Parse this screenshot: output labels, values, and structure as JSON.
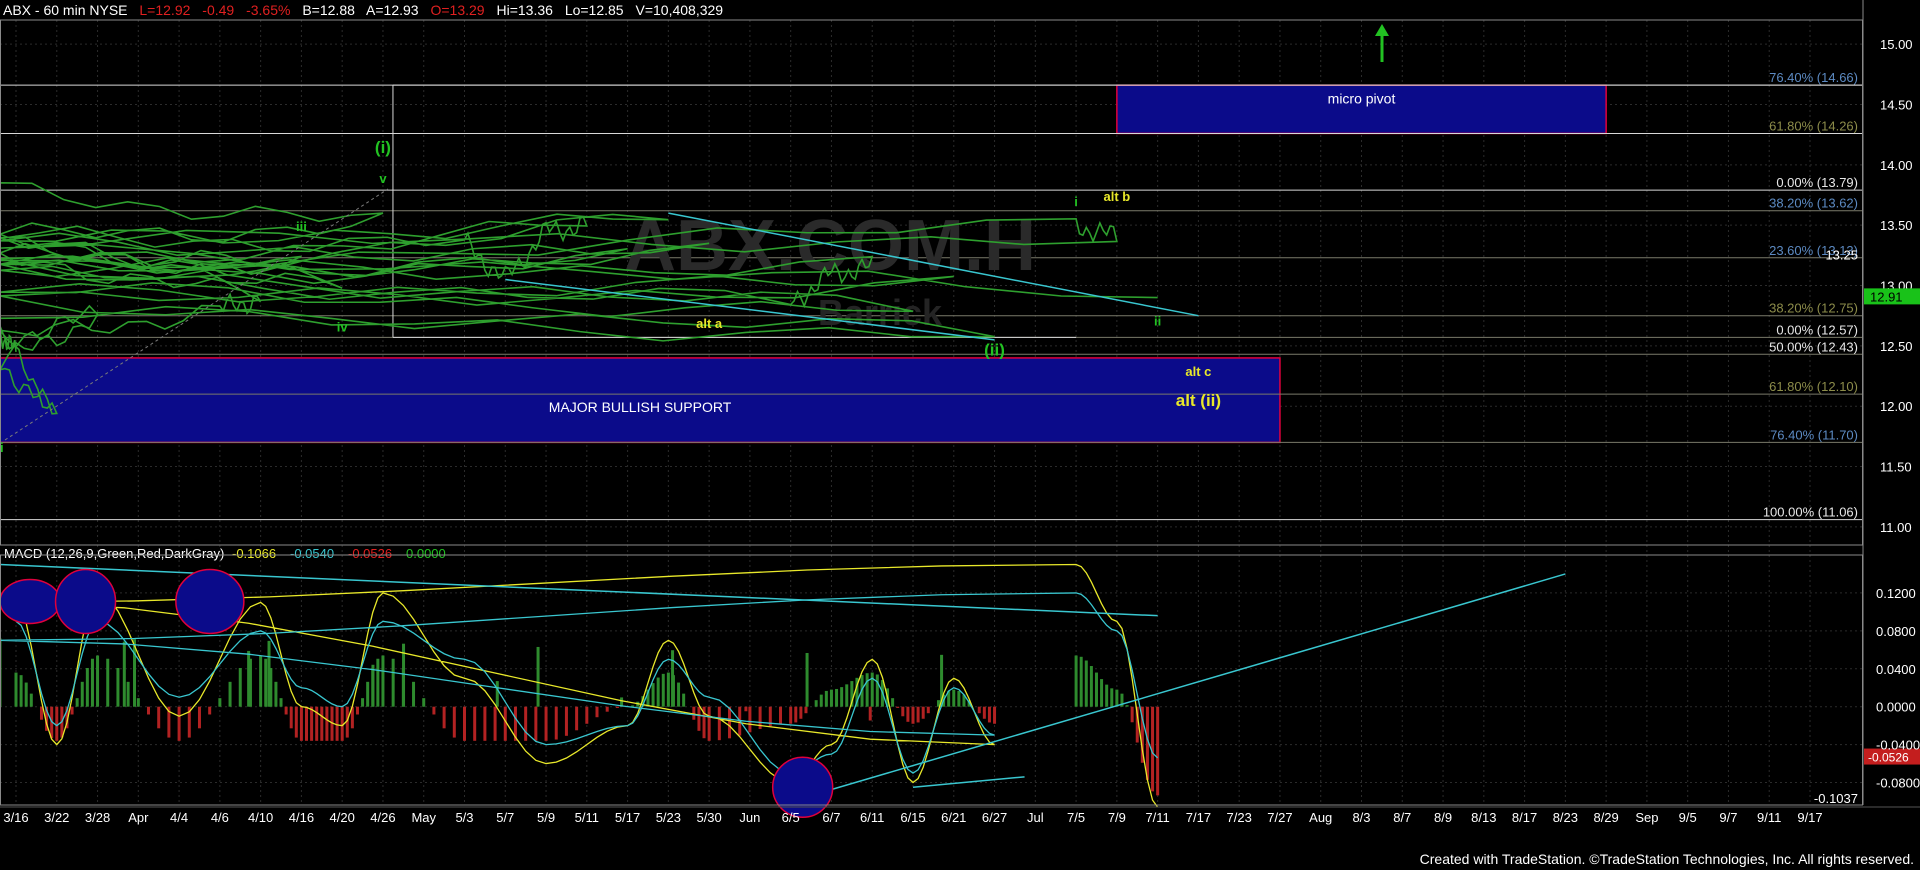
{
  "header": {
    "symbol": "ABX - 60 min NYSE",
    "last": "L=12.92",
    "change": "-0.49",
    "change_pct": "-3.65%",
    "bid": "B=12.88",
    "ask": "A=12.93",
    "open": "O=13.29",
    "high": "Hi=13.36",
    "low": "Lo=12.85",
    "volume": "V=10,408,329"
  },
  "watermark": "ABX.COM.H",
  "watermark_sub": "Barrick",
  "footer": "Created with TradeStation. ©TradeStation Technologies, Inc. All rights reserved.",
  "colors": {
    "background": "#000000",
    "price": "#2e9f2e",
    "fib_label": "#5c8ac2",
    "support_box": "#0b0b8a",
    "box_border": "#e0003c",
    "wave_green": "#22c222",
    "wave_yellow": "#e8e82a",
    "trendline": "#39c6cf",
    "macd_pos": "#2e8b2e",
    "macd_neg": "#b22222",
    "last_price_bg": "#19c219"
  },
  "chart_data": [
    {
      "type": "line",
      "title": "ABX - 60 min NYSE",
      "ylim": [
        10.85,
        15.2
      ],
      "y_ticks": [
        "15.00",
        "14.50",
        "14.00",
        "13.50",
        "13.00",
        "12.50",
        "12.00",
        "11.50",
        "11.00"
      ],
      "x_tick_labels": [
        "3/16",
        "3/22",
        "3/28",
        "Apr",
        "4/4",
        "4/6",
        "4/10",
        "4/16",
        "4/20",
        "4/26",
        "May",
        "5/3",
        "5/7",
        "5/9",
        "5/11",
        "5/17",
        "5/23",
        "5/30",
        "Jun",
        "6/5",
        "6/7",
        "6/11",
        "6/15",
        "6/21",
        "6/27",
        "Jul",
        "7/5",
        "7/9",
        "7/11",
        "7/17",
        "7/23",
        "7/27",
        "Aug",
        "8/3",
        "8/7",
        "8/9",
        "8/13",
        "8/17",
        "8/23",
        "8/29",
        "Sep",
        "9/5",
        "9/7",
        "9/11",
        "9/17"
      ],
      "series": [
        {
          "x": [
            "3/16",
            "3/20",
            "3/22",
            "3/26",
            "3/28",
            "4/2",
            "4/6",
            "4/10",
            "4/12",
            "4/16",
            "4/18",
            "4/20",
            "4/24",
            "4/26",
            "4/28",
            "4/30",
            "5/3",
            "5/7",
            "5/9",
            "5/11",
            "5/15",
            "5/17",
            "5/21",
            "5/23",
            "5/25",
            "5/30",
            "6/1",
            "6/5",
            "6/7",
            "6/11",
            "6/13",
            "6/15",
            "6/19",
            "6/21",
            "6/25",
            "6/27",
            "6/29",
            "7/2",
            "7/5",
            "7/9",
            "7/10",
            "7/11"
          ],
          "values": [
            12.45,
            12.6,
            11.93,
            12.35,
            12.75,
            12.55,
            12.8,
            12.9,
            13.25,
            13.15,
            13.35,
            13.0,
            13.4,
            13.5,
            13.79,
            13.4,
            13.35,
            13.05,
            13.45,
            13.5,
            13.15,
            13.2,
            13.05,
            13.55,
            13.35,
            13.25,
            13.1,
            12.85,
            13.1,
            13.15,
            13.15,
            12.8,
            12.95,
            13.0,
            12.85,
            12.6,
            12.75,
            13.15,
            13.5,
            13.4,
            13.35,
            12.9
          ]
        }
      ],
      "last_price_label": "12.91",
      "price_marker": "13.25",
      "fib_levels": [
        {
          "label": "76.40% (14.66)",
          "value": 14.66
        },
        {
          "label": "61.80% (14.26)",
          "value": 14.26
        },
        {
          "label": "0.00% (13.79)",
          "value": 13.79
        },
        {
          "label": "38.20% (13.62)",
          "value": 13.62
        },
        {
          "label": "23.60% (13.13)",
          "value": 13.23
        },
        {
          "label": "38.20% (12.75)",
          "value": 12.75
        },
        {
          "label": "0.00% (12.57)",
          "value": 12.57
        },
        {
          "label": "50.00% (12.43)",
          "value": 12.43
        },
        {
          "label": "61.80% (12.10)",
          "value": 12.1
        },
        {
          "label": "76.40% (11.70)",
          "value": 11.7
        },
        {
          "label": "100.00% (11.06)",
          "value": 11.06
        }
      ],
      "zones": [
        {
          "label": "micro pivot",
          "x_from": "7/9",
          "x_to": "8/29",
          "y_from": 14.26,
          "y_to": 14.66
        },
        {
          "label": "MAJOR BULLISH SUPPORT",
          "x_from": "5/25",
          "x_to": "7/27",
          "y_from": 11.7,
          "y_to": 12.4
        }
      ],
      "annotations": [
        {
          "text": "(i)",
          "color": "green",
          "x": "4/26",
          "y": 14.1
        },
        {
          "text": "v",
          "color": "green",
          "x": "4/26",
          "y": 13.85
        },
        {
          "text": "iii",
          "color": "green",
          "x": "4/16",
          "y": 13.45
        },
        {
          "text": "iv",
          "color": "green",
          "x": "4/20",
          "y": 12.62
        },
        {
          "text": "ii",
          "color": "green",
          "x": "3/20",
          "y": 11.62
        },
        {
          "text": "(ii)",
          "color": "green",
          "x": "6/27",
          "y": 12.42
        },
        {
          "text": "i",
          "color": "green",
          "x": "7/5",
          "y": 13.66
        },
        {
          "text": "alt b",
          "color": "yellow",
          "x": "7/9",
          "y": 13.7
        },
        {
          "text": "ii",
          "color": "green",
          "x": "7/11",
          "y": 12.67
        },
        {
          "text": "alt a",
          "color": "yellow",
          "x": "5/30",
          "y": 12.65
        },
        {
          "text": "alt c",
          "color": "yellow",
          "x": "7/17",
          "y": 12.25
        },
        {
          "text": "alt (ii)",
          "color": "yellow",
          "x": "7/17",
          "y": 12.0
        }
      ]
    },
    {
      "type": "bar",
      "title": "MACD (12,26,9,Green,Red,DarkGray)",
      "legend_values": [
        "-0.1066",
        "-0.0540",
        "-0.0526",
        "0.0000"
      ],
      "ylim": [
        -0.1037,
        0.16
      ],
      "y_ticks": [
        "0.1200",
        "0.0800",
        "0.0400",
        "0.0000",
        "-0.0400",
        "-0.0800"
      ],
      "value_labels": [
        {
          "text": "-0.0526",
          "value": -0.0526
        },
        {
          "text": "-0.1037",
          "value": -0.1037
        }
      ],
      "series": [
        {
          "name": "MACD",
          "x": [
            "3/16",
            "3/22",
            "3/28",
            "4/4",
            "4/10",
            "4/16",
            "4/20",
            "4/26",
            "5/3",
            "5/9",
            "5/17",
            "5/23",
            "5/30",
            "6/5",
            "6/7",
            "6/11",
            "6/15",
            "6/21",
            "6/27",
            "7/2",
            "7/5",
            "7/9",
            "7/11"
          ],
          "values": [
            0.11,
            -0.04,
            0.12,
            -0.01,
            0.11,
            0.0,
            -0.02,
            0.12,
            0.03,
            -0.06,
            -0.02,
            0.07,
            -0.01,
            -0.08,
            -0.04,
            0.05,
            -0.08,
            0.03,
            -0.04,
            0.11,
            0.15,
            0.09,
            -0.106
          ]
        },
        {
          "name": "Signal",
          "x": [
            "3/16",
            "3/22",
            "3/28",
            "4/4",
            "4/10",
            "4/16",
            "4/20",
            "4/26",
            "5/3",
            "5/9",
            "5/17",
            "5/23",
            "5/30",
            "6/5",
            "6/7",
            "6/11",
            "6/15",
            "6/21",
            "6/27",
            "7/2",
            "7/5",
            "7/9",
            "7/11"
          ],
          "values": [
            0.09,
            -0.02,
            0.09,
            0.01,
            0.08,
            0.02,
            0.0,
            0.09,
            0.05,
            -0.04,
            -0.02,
            0.05,
            0.01,
            -0.07,
            -0.05,
            0.03,
            -0.07,
            0.02,
            -0.03,
            0.07,
            0.12,
            0.08,
            -0.054
          ]
        }
      ]
    }
  ]
}
